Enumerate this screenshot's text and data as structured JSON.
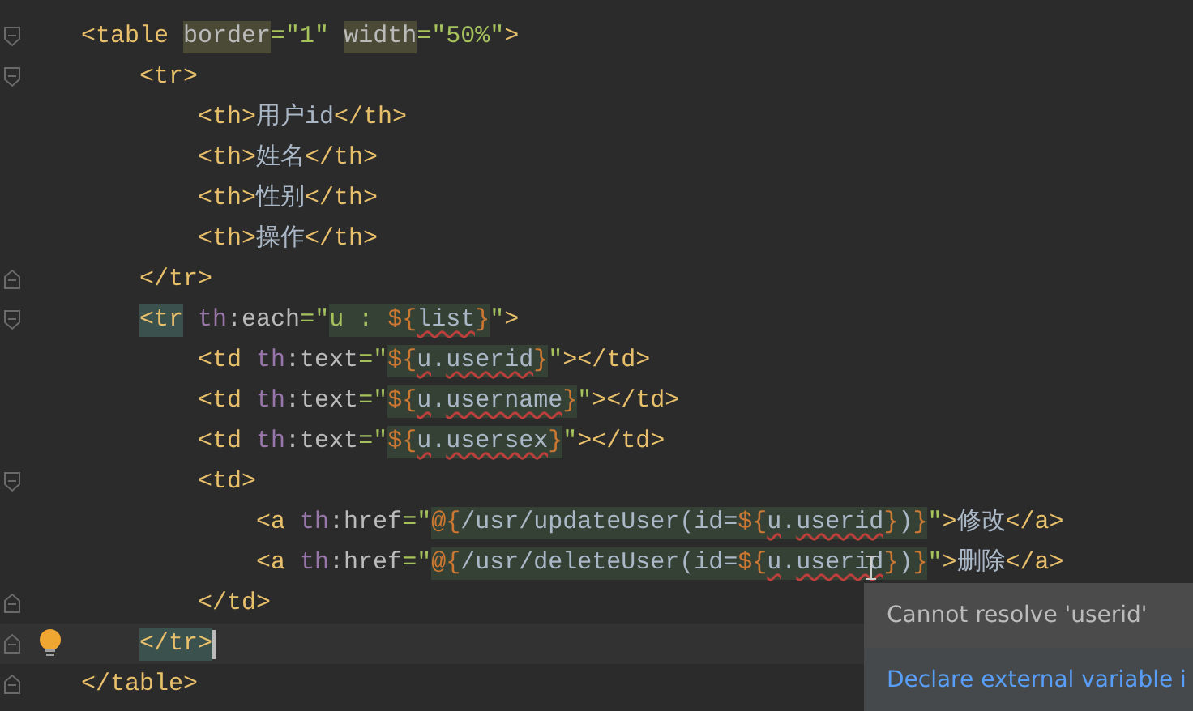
{
  "editor": {
    "lines": [
      {
        "fold_start": true,
        "tokens": [
          {
            "kind": "tag",
            "text": "    <table "
          },
          {
            "kind": "attr",
            "text": "border",
            "matched": true
          },
          {
            "kind": "string",
            "text": "=\"1\" "
          },
          {
            "kind": "attr",
            "text": "width",
            "matched": true
          },
          {
            "kind": "string",
            "text": "=\"50%\""
          },
          {
            "kind": "tag",
            "text": ">"
          }
        ]
      },
      {
        "fold_start": true,
        "tokens": [
          {
            "kind": "tag",
            "text": "        <tr>"
          }
        ]
      },
      {
        "tokens": [
          {
            "kind": "tag",
            "text": "            <th>"
          },
          {
            "kind": "text",
            "text": "用户id"
          },
          {
            "kind": "tag",
            "text": "</th>"
          }
        ]
      },
      {
        "tokens": [
          {
            "kind": "tag",
            "text": "            <th>"
          },
          {
            "kind": "text",
            "text": "姓名"
          },
          {
            "kind": "tag",
            "text": "</th>"
          }
        ]
      },
      {
        "tokens": [
          {
            "kind": "tag",
            "text": "            <th>"
          },
          {
            "kind": "text",
            "text": "性别"
          },
          {
            "kind": "tag",
            "text": "</th>"
          }
        ]
      },
      {
        "tokens": [
          {
            "kind": "tag",
            "text": "            <th>"
          },
          {
            "kind": "text",
            "text": "操作"
          },
          {
            "kind": "tag",
            "text": "</th>"
          }
        ]
      },
      {
        "fold_end": true,
        "tokens": [
          {
            "kind": "tag",
            "text": "        </tr>"
          }
        ]
      },
      {
        "fold_start": true,
        "tokens": [
          {
            "kind": "tag",
            "text": "        <tr",
            "brace_match": true
          },
          {
            "kind": "ns",
            "text": " th"
          },
          {
            "kind": "attr",
            "text": ":each"
          },
          {
            "kind": "string",
            "text": "=\""
          },
          {
            "kind": "string",
            "text": "u : ",
            "injected": true
          },
          {
            "kind": "delim",
            "text": "${",
            "injected": true
          },
          {
            "kind": "error",
            "text": "list",
            "injected": true
          },
          {
            "kind": "delim",
            "text": "}",
            "injected": true
          },
          {
            "kind": "string",
            "text": "\""
          },
          {
            "kind": "tag",
            "text": ">"
          }
        ]
      },
      {
        "tokens": [
          {
            "kind": "tag",
            "text": "            <td"
          },
          {
            "kind": "ns",
            "text": " th"
          },
          {
            "kind": "attr",
            "text": ":text"
          },
          {
            "kind": "string",
            "text": "=\""
          },
          {
            "kind": "delim",
            "text": "${",
            "injected": true
          },
          {
            "kind": "error",
            "text": "u",
            "injected": true
          },
          {
            "kind": "text",
            "text": ".",
            "injected": true
          },
          {
            "kind": "error",
            "text": "userid",
            "injected": true
          },
          {
            "kind": "delim",
            "text": "}",
            "injected": true
          },
          {
            "kind": "string",
            "text": "\""
          },
          {
            "kind": "tag",
            "text": "></td>"
          }
        ]
      },
      {
        "tokens": [
          {
            "kind": "tag",
            "text": "            <td"
          },
          {
            "kind": "ns",
            "text": " th"
          },
          {
            "kind": "attr",
            "text": ":text"
          },
          {
            "kind": "string",
            "text": "=\""
          },
          {
            "kind": "delim",
            "text": "${",
            "injected": true
          },
          {
            "kind": "error",
            "text": "u",
            "injected": true
          },
          {
            "kind": "text",
            "text": ".",
            "injected": true
          },
          {
            "kind": "error",
            "text": "username",
            "injected": true
          },
          {
            "kind": "delim",
            "text": "}",
            "injected": true
          },
          {
            "kind": "string",
            "text": "\""
          },
          {
            "kind": "tag",
            "text": "></td>"
          }
        ]
      },
      {
        "tokens": [
          {
            "kind": "tag",
            "text": "            <td"
          },
          {
            "kind": "ns",
            "text": " th"
          },
          {
            "kind": "attr",
            "text": ":text"
          },
          {
            "kind": "string",
            "text": "=\""
          },
          {
            "kind": "delim",
            "text": "${",
            "injected": true
          },
          {
            "kind": "error",
            "text": "u",
            "injected": true
          },
          {
            "kind": "text",
            "text": ".",
            "injected": true
          },
          {
            "kind": "error",
            "text": "usersex",
            "injected": true
          },
          {
            "kind": "delim",
            "text": "}",
            "injected": true
          },
          {
            "kind": "string",
            "text": "\""
          },
          {
            "kind": "tag",
            "text": "></td>"
          }
        ]
      },
      {
        "fold_start": true,
        "tokens": [
          {
            "kind": "tag",
            "text": "            <td>"
          }
        ]
      },
      {
        "tokens": [
          {
            "kind": "tag",
            "text": "                <a"
          },
          {
            "kind": "ns",
            "text": " th"
          },
          {
            "kind": "attr",
            "text": ":href"
          },
          {
            "kind": "string",
            "text": "=\""
          },
          {
            "kind": "delim",
            "text": "@{",
            "injected": true
          },
          {
            "kind": "text",
            "text": "/usr/updateUser(id=",
            "injected": true
          },
          {
            "kind": "delim",
            "text": "${",
            "injected": true
          },
          {
            "kind": "error",
            "text": "u",
            "injected": true
          },
          {
            "kind": "text",
            "text": ".",
            "injected": true
          },
          {
            "kind": "error",
            "text": "userid",
            "injected": true
          },
          {
            "kind": "delim",
            "text": "}",
            "injected": true
          },
          {
            "kind": "text",
            "text": ")",
            "injected": true
          },
          {
            "kind": "delim",
            "text": "}",
            "injected": true
          },
          {
            "kind": "string",
            "text": "\""
          },
          {
            "kind": "tag",
            "text": ">"
          },
          {
            "kind": "text",
            "text": "修改"
          },
          {
            "kind": "tag",
            "text": "</a>"
          }
        ]
      },
      {
        "tokens": [
          {
            "kind": "tag",
            "text": "                <a"
          },
          {
            "kind": "ns",
            "text": " th"
          },
          {
            "kind": "attr",
            "text": ":href"
          },
          {
            "kind": "string",
            "text": "=\""
          },
          {
            "kind": "delim",
            "text": "@{",
            "injected": true
          },
          {
            "kind": "text",
            "text": "/usr/deleteUser(id=",
            "injected": true
          },
          {
            "kind": "delim",
            "text": "${",
            "injected": true
          },
          {
            "kind": "error",
            "text": "u",
            "injected": true
          },
          {
            "kind": "text",
            "text": ".",
            "injected": true
          },
          {
            "kind": "error",
            "text": "userid",
            "injected": true
          },
          {
            "kind": "delim",
            "text": "}",
            "injected": true
          },
          {
            "kind": "text",
            "text": ")",
            "injected": true
          },
          {
            "kind": "delim",
            "text": "}",
            "injected": true
          },
          {
            "kind": "string",
            "text": "\""
          },
          {
            "kind": "tag",
            "text": ">"
          },
          {
            "kind": "text",
            "text": "删除"
          },
          {
            "kind": "tag",
            "text": "</a>"
          }
        ]
      },
      {
        "fold_end": true,
        "tokens": [
          {
            "kind": "tag",
            "text": "            </td>"
          }
        ]
      },
      {
        "fold_end": true,
        "current": true,
        "bulb": true,
        "caret": true,
        "tokens": [
          {
            "kind": "tag",
            "text": "        </tr>",
            "brace_match": true
          }
        ]
      },
      {
        "fold_end": true,
        "tokens": [
          {
            "kind": "tag",
            "text": "    </table>"
          }
        ]
      }
    ]
  },
  "popup": {
    "message": "Cannot resolve 'userid'",
    "action": "Declare external variable i"
  }
}
